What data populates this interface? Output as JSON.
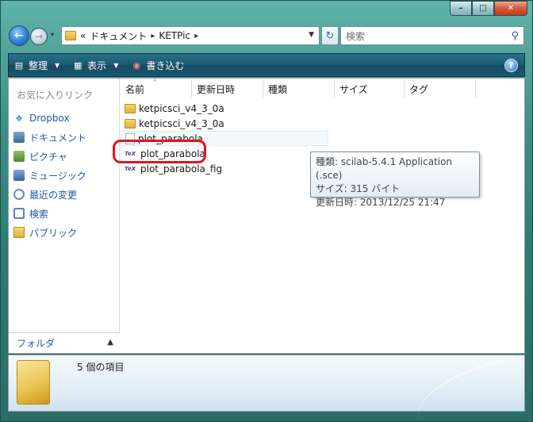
{
  "window": {
    "controls": {
      "minimize": "–",
      "maximize": "□",
      "close": "✕"
    }
  },
  "nav": {
    "back": "←",
    "forward": "→",
    "history": "▾",
    "breadcrumb": [
      "«",
      "ドキュメント",
      "KETPic"
    ],
    "refresh": "↻",
    "search_placeholder": "検索"
  },
  "toolbar": {
    "organize": "整理",
    "view": "表示",
    "burn": "書き込む",
    "help": "?"
  },
  "sidebar": {
    "heading": "お気に入りリンク",
    "items": [
      {
        "label": "Dropbox",
        "icon": "dropbox-icon"
      },
      {
        "label": "ドキュメント",
        "icon": "documents-icon"
      },
      {
        "label": "ピクチャ",
        "icon": "pictures-icon"
      },
      {
        "label": "ミュージック",
        "icon": "music-icon"
      },
      {
        "label": "最近の変更",
        "icon": "recent-changes-icon"
      },
      {
        "label": "検索",
        "icon": "searches-icon"
      },
      {
        "label": "パブリック",
        "icon": "public-icon"
      }
    ],
    "folders_label": "フォルダ"
  },
  "columns": [
    {
      "label": "名前"
    },
    {
      "label": "更新日時"
    },
    {
      "label": "種類"
    },
    {
      "label": "サイズ"
    },
    {
      "label": "タグ"
    }
  ],
  "files": [
    {
      "name": "ketpicsci_v4_3_0a",
      "type": "folder"
    },
    {
      "name": "ketpicsci_v4_3_0a",
      "type": "folder"
    },
    {
      "name": "plot_parabola",
      "type": "file"
    },
    {
      "name": "plot_parabola",
      "type": "sce"
    },
    {
      "name": "plot_parabola_fig",
      "type": "sce"
    }
  ],
  "tooltip": {
    "line1": "種類: scilab-5.4.1 Application (.sce)",
    "line2": "サイズ: 315 バイト",
    "line3": "更新日時: 2013/12/25 21:47"
  },
  "details": {
    "count": "5 個の項目"
  },
  "colors": {
    "highlight_ring": "#e2131c",
    "link_blue": "#1f56a8"
  }
}
